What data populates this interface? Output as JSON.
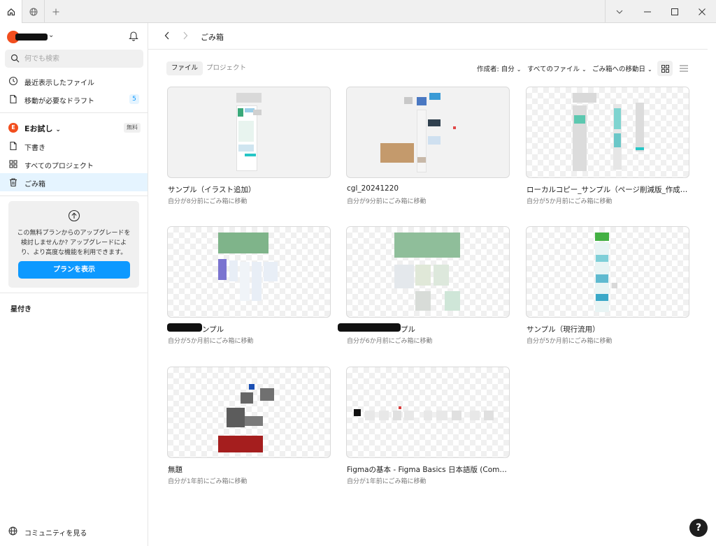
{
  "titlebar": {
    "home_icon": "home-icon",
    "globe_icon": "globe-icon",
    "new_tab_icon": "plus-icon"
  },
  "sidebar": {
    "search_placeholder": "何でも検索",
    "items": [
      {
        "label": "最近表示したファイル",
        "icon": "clock-icon"
      },
      {
        "label": "移動が必要なドラフト",
        "icon": "file-icon",
        "badge": "5"
      }
    ],
    "team": {
      "initial": "E",
      "name": "Eお試し",
      "plan_badge": "無料"
    },
    "team_items": [
      {
        "label": "下書き",
        "icon": "file-icon"
      },
      {
        "label": "すべてのプロジェクト",
        "icon": "grid-icon"
      },
      {
        "label": "ごみ箱",
        "icon": "trash-icon",
        "active": true
      }
    ],
    "upgrade": {
      "text": "この無料プランからのアップグレードを検討しませんか? アップグレードにより、より高度な機能を利用できます。",
      "button": "プランを表示"
    },
    "starred_label": "星付き",
    "community_label": "コミュニティを見る"
  },
  "header": {
    "breadcrumb": "ごみ箱"
  },
  "toolbar": {
    "tab_files": "ファイル",
    "tab_projects": "プロジェクト",
    "filter_owner": "作成者: 自分",
    "filter_type": "すべてのファイル",
    "sort": "ごみ箱への移動日"
  },
  "files": [
    {
      "title": "サンプル（イラスト追加）",
      "subtitle": "自分が8分前にごみ箱に移動"
    },
    {
      "title": "cgl_20241220",
      "subtitle": "自分が9分前にごみ箱に移動"
    },
    {
      "title": "ローカルコピー_サンプル（ページ削減版_作成…",
      "subtitle": "自分が5か月前にごみ箱に移動"
    },
    {
      "title": "ンプル",
      "subtitle": "自分が5か月前にごみ箱に移動"
    },
    {
      "title": "プル",
      "subtitle": "自分が6か月前にごみ箱に移動"
    },
    {
      "title": "サンプル（現行流用）",
      "subtitle": "自分が5か月前にごみ箱に移動"
    },
    {
      "title": "無題",
      "subtitle": "自分が1年前にごみ箱に移動"
    },
    {
      "title": "Figmaの基本 - Figma Basics 日本語版 (Comm…",
      "subtitle": "自分が1年前にごみ箱に移動"
    }
  ],
  "help_label": "?",
  "colors": {
    "accent": "#0d99ff",
    "brand_orange": "#f24e1e"
  }
}
